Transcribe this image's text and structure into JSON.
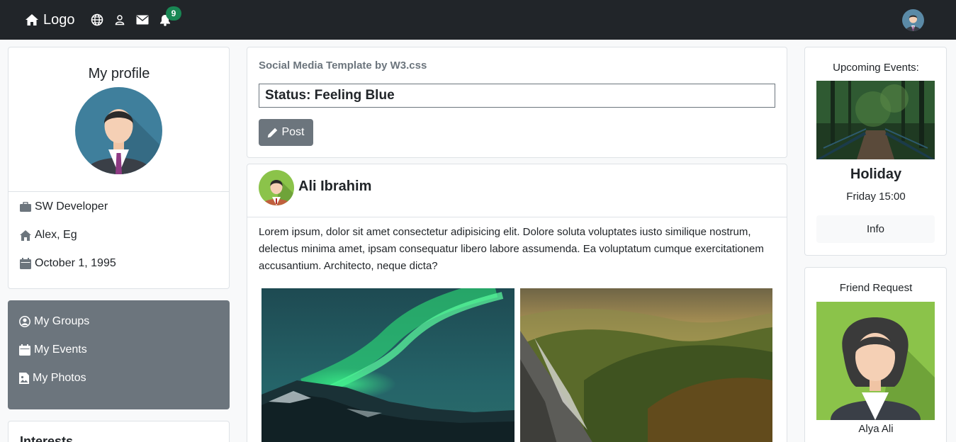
{
  "navbar": {
    "logo_label": "Logo",
    "badge_count": "9",
    "icons": [
      "home-icon",
      "globe-icon",
      "user-icon",
      "envelope-icon",
      "bell-icon"
    ]
  },
  "profile": {
    "title": "My profile",
    "job": "SW Developer",
    "location": "Alex, Eg",
    "birthday": "October 1, 1995"
  },
  "groups": {
    "items": [
      {
        "label": "My Groups",
        "icon": "user-circle-icon"
      },
      {
        "label": "My Events",
        "icon": "calendar-icon"
      },
      {
        "label": "My Photos",
        "icon": "photo-icon"
      }
    ]
  },
  "interests": {
    "title": "Interests"
  },
  "status": {
    "subtitle": "Social Media Template by W3.css",
    "value": "Status: Feeling Blue",
    "post_label": "Post"
  },
  "post": {
    "author": "Ali Ibrahim",
    "body": "Lorem ipsum, dolor sit amet consectetur adipisicing elit. Dolore soluta voluptates iusto similique nostrum, delectus minima amet, ipsam consequatur libero labore assumenda. Ea voluptatum cumque exercitationem accusantium. Architecto, neque dicta?"
  },
  "events": {
    "title": "Upcoming Events:",
    "name": "Holiday",
    "time": "Friday 15:00",
    "button_label": "Info"
  },
  "friend_request": {
    "title": "Friend Request",
    "name": "Alya Ali"
  },
  "colors": {
    "navbar": "#212529",
    "badge": "#198754",
    "secondary": "#6c757d",
    "page": "#f8f9fa"
  }
}
